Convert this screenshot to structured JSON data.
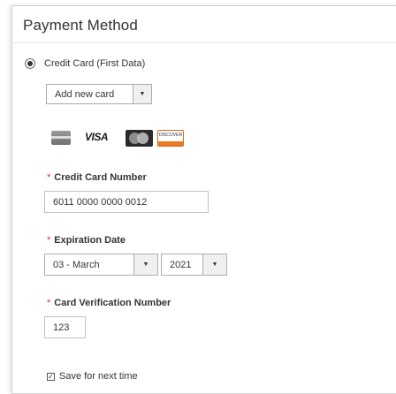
{
  "header": {
    "title": "Payment Method"
  },
  "payment_option": {
    "label": "Credit Card (First Data)",
    "selected": true
  },
  "saved_card_select": {
    "value": "Add new card"
  },
  "card_types": [
    "amex-icon",
    "visa-icon",
    "mastercard-icon",
    "discover-icon"
  ],
  "card_labels": {
    "visa": "VISA",
    "discover": "DISCOVER"
  },
  "required_marker": "*",
  "card_number": {
    "label": "Credit Card Number",
    "value": "6011 0000 0000 0012"
  },
  "expiration": {
    "label": "Expiration Date",
    "month": "03 - March",
    "year": "2021"
  },
  "cvv": {
    "label": "Card Verification Number",
    "value": "123"
  },
  "save_card": {
    "label": "Save for next time",
    "checked": true
  },
  "colors": {
    "required": "#e02b27",
    "border": "#c2c2c2",
    "text": "#333333"
  }
}
